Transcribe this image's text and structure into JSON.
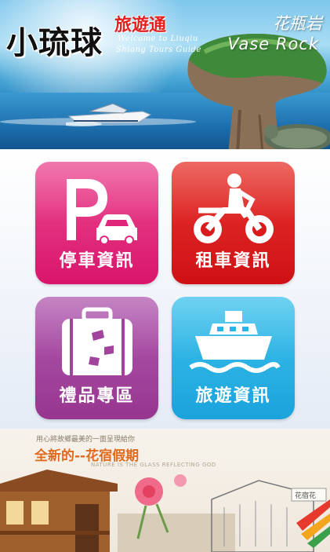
{
  "banner": {
    "title": "小琉球",
    "subtitle": "旅遊通",
    "welcome_line1": "Welcome to Liuqiu",
    "welcome_line2": "Shiang Tours Guide",
    "landmark_zh": "花瓶岩",
    "landmark_en": "Vase Rock"
  },
  "tiles": [
    {
      "label": "停車資訊",
      "icon": "parking-car-icon",
      "color": "#e0267a"
    },
    {
      "label": "租車資訊",
      "icon": "scooter-rider-icon",
      "color": "#d91a1d"
    },
    {
      "label": "禮品專區",
      "icon": "suitcase-icon",
      "color": "#a2439d"
    },
    {
      "label": "旅遊資訊",
      "icon": "ferry-boat-icon",
      "color": "#2fb3e4"
    }
  ],
  "ad": {
    "small_text": "用心將故鄉最美的一面呈現給你",
    "title": "全新的--花宿假期",
    "english": "NATURE IS THE GLASS REFLECTING GOD",
    "sign": "花宿花"
  }
}
